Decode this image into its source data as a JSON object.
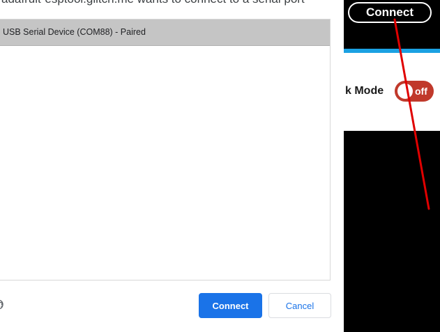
{
  "dialog": {
    "title": "adafruit-esptool.glitch.me wants to connect to a serial port",
    "ports": [
      {
        "label": "USB Serial Device (COM88) - Paired",
        "selected": true
      }
    ],
    "connect_label": "Connect",
    "cancel_label": "Cancel",
    "help_icon": "help-circle-icon"
  },
  "page": {
    "connect_label": "Connect",
    "mode_label": "k Mode",
    "toggle_state": "off"
  },
  "colors": {
    "primary_button": "#1a73e8",
    "selected_row": "#c5c5c5",
    "toggle_off": "#c0392b",
    "accent_bar": "#1ba1e2",
    "annotation": "#e00000"
  }
}
